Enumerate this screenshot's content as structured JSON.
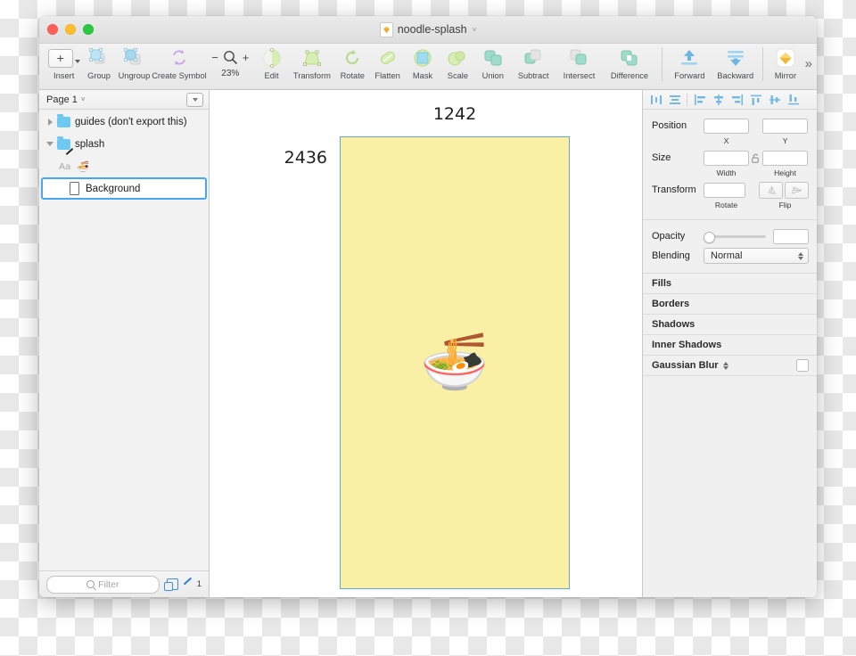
{
  "window": {
    "title": "noodle-splash",
    "doc_icon": "sketch-diamond-icon",
    "title_chevron": "˅"
  },
  "traffic_lights": {
    "close": "close-button",
    "minimize": "minimize-button",
    "zoom": "zoom-button"
  },
  "toolbar": {
    "insert_label": "Insert",
    "group_label": "Group",
    "ungroup_label": "Ungroup",
    "create_symbol_label": "Create Symbol",
    "zoom_minus": "−",
    "zoom_plus": "+",
    "zoom_percent": "23%",
    "edit_label": "Edit",
    "transform_label": "Transform",
    "rotate_label": "Rotate",
    "flatten_label": "Flatten",
    "mask_label": "Mask",
    "scale_label": "Scale",
    "union_label": "Union",
    "subtract_label": "Subtract",
    "intersect_label": "Intersect",
    "difference_label": "Difference",
    "forward_label": "Forward",
    "backward_label": "Backward",
    "mirror_label": "Mirror",
    "overflow_label": "»"
  },
  "layers_panel": {
    "page_name": "Page 1",
    "page_chevron": "˅",
    "rows": [
      {
        "label": "guides (don't export this)",
        "type": "folder",
        "expanded": false,
        "selected": false
      },
      {
        "label": "splash",
        "type": "folder-artboard",
        "expanded": true,
        "selected": false
      },
      {
        "label": "🍜",
        "type": "text",
        "icon_label": "Aa",
        "selected": false
      },
      {
        "label": "Background",
        "type": "shape",
        "selected": true
      }
    ],
    "footer": {
      "filter_placeholder": "Filter",
      "duplicate_icon": "duplicate-icon",
      "pen_icon": "pen-icon",
      "count": "1"
    }
  },
  "canvas": {
    "dimension_width": "1242",
    "dimension_height": "2436",
    "artboard_fill": "#faf0a5",
    "artboard_border": "#57abea",
    "content_emoji": "🍜"
  },
  "inspector": {
    "align_buttons": [
      "distribute-horizontally-icon",
      "distribute-vertically-icon",
      "align-left-icon",
      "align-center-icon",
      "align-right-icon",
      "align-top-icon",
      "align-middle-icon",
      "align-bottom-icon"
    ],
    "position_label": "Position",
    "position_x_value": "",
    "position_y_value": "",
    "position_x_sub": "X",
    "position_y_sub": "Y",
    "size_label": "Size",
    "size_w_value": "",
    "size_h_value": "",
    "size_w_sub": "Width",
    "size_h_sub": "Height",
    "lock_icon": "lock-open-icon",
    "transform_label": "Transform",
    "transform_rotate_value": "",
    "transform_rotate_sub": "Rotate",
    "transform_flip_sub": "Flip",
    "flip_horizontal_icon": "flip-horizontal-icon",
    "flip_vertical_icon": "flip-vertical-icon",
    "opacity_label": "Opacity",
    "opacity_value": "",
    "blending_label": "Blending",
    "blending_value": "Normal",
    "style_sections": [
      {
        "label": "Fills"
      },
      {
        "label": "Borders"
      },
      {
        "label": "Shadows"
      },
      {
        "label": "Inner Shadows"
      }
    ],
    "blur_label": "Gaussian Blur",
    "blur_stepper": "blur-type-stepper",
    "blur_checkbox": "blur-enabled-checkbox"
  }
}
